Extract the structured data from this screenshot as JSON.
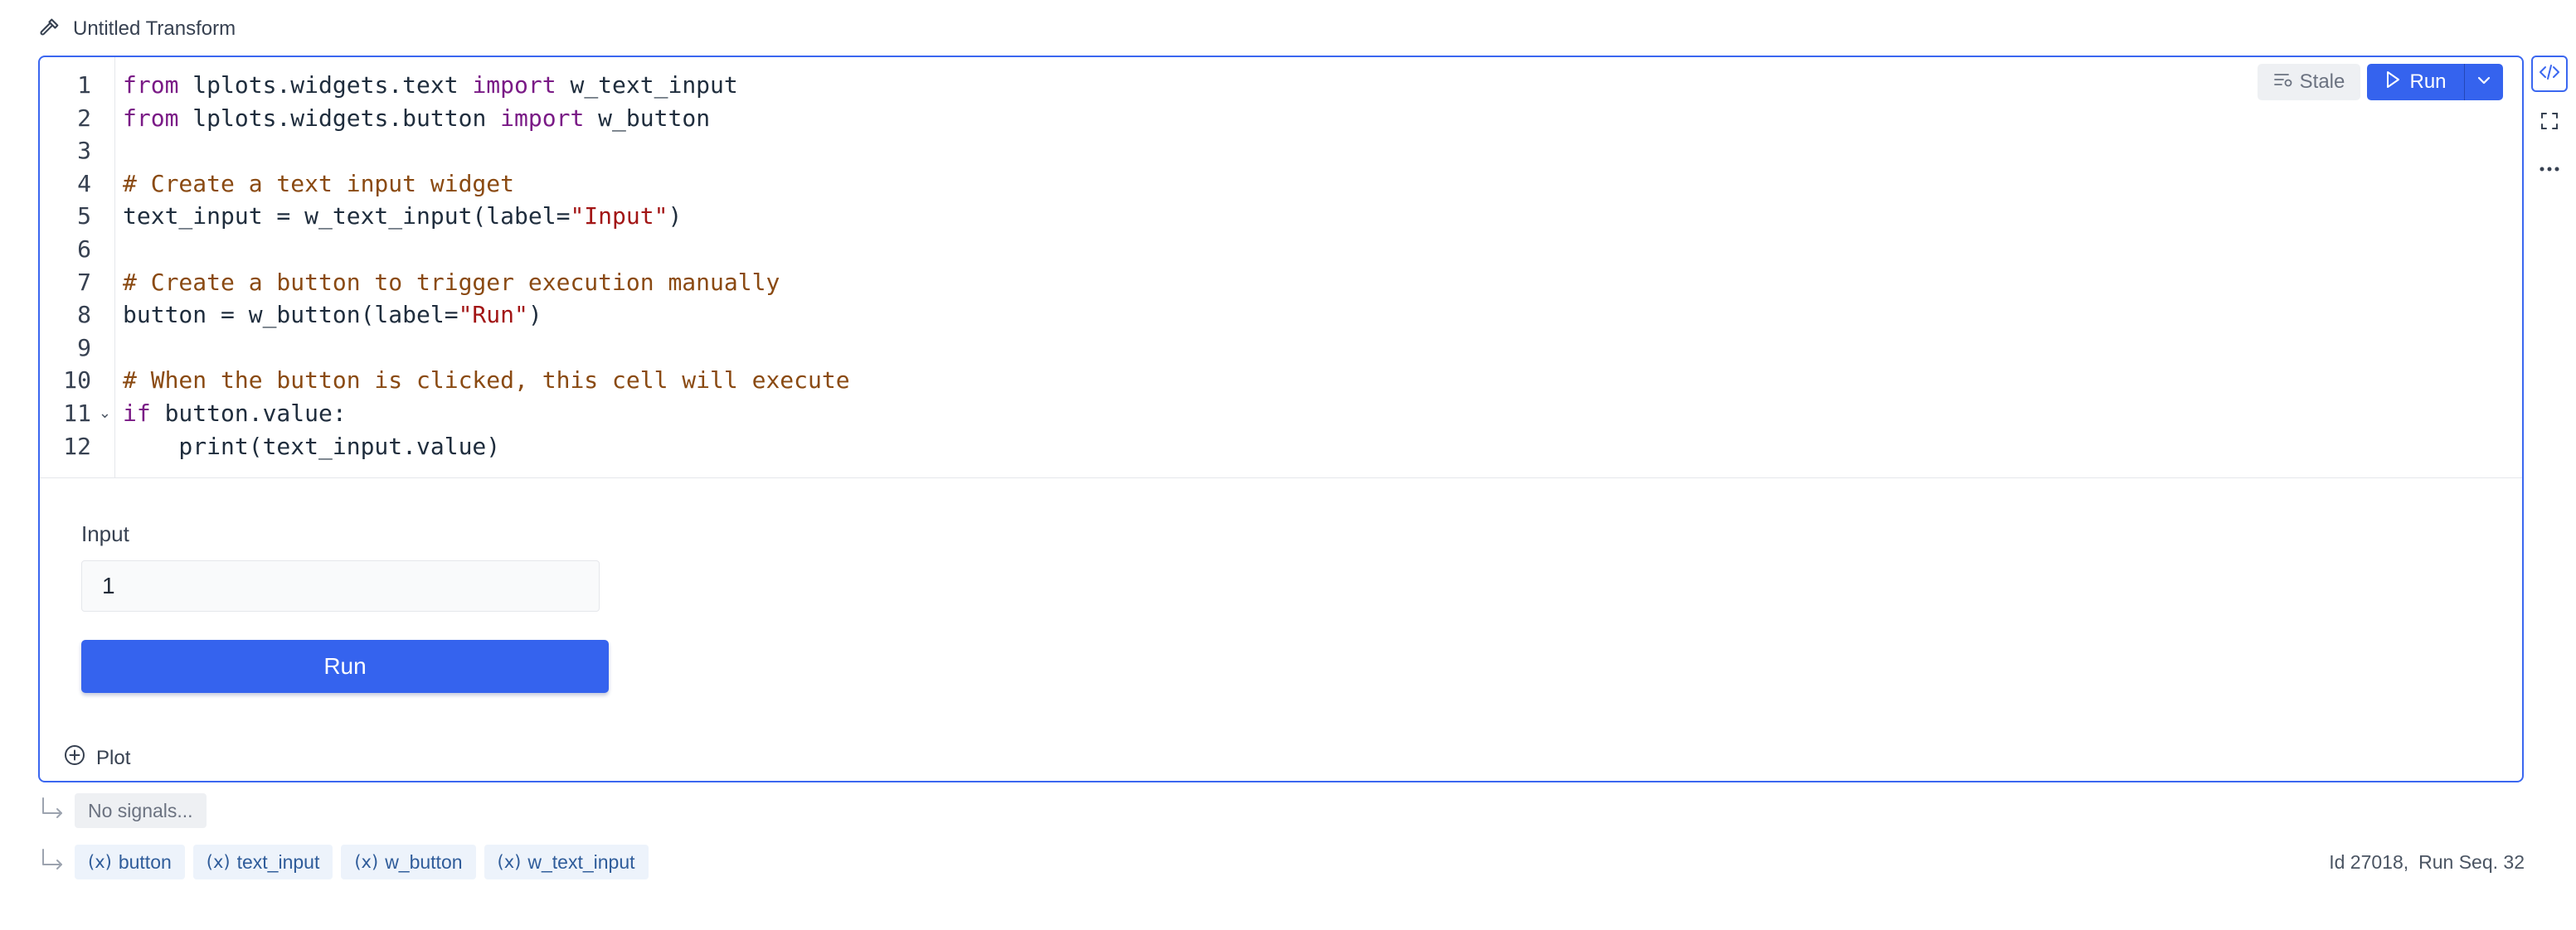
{
  "header": {
    "title": "Untitled Transform",
    "icon": "hammer-icon"
  },
  "editor": {
    "stale_label": "Stale",
    "run_label": "Run",
    "lines": [
      {
        "n": "1",
        "parts": [
          [
            "kw",
            "from"
          ],
          [
            "",
            " lplots.widgets.text "
          ],
          [
            "kw",
            "import"
          ],
          [
            "",
            " w_text_input"
          ]
        ]
      },
      {
        "n": "2",
        "parts": [
          [
            "kw",
            "from"
          ],
          [
            "",
            " lplots.widgets.button "
          ],
          [
            "kw",
            "import"
          ],
          [
            "",
            " w_button"
          ]
        ]
      },
      {
        "n": "3",
        "parts": []
      },
      {
        "n": "4",
        "parts": [
          [
            "cm",
            "# Create a text input widget"
          ]
        ]
      },
      {
        "n": "5",
        "parts": [
          [
            "",
            "text_input = w_text_input(label="
          ],
          [
            "st",
            "\"Input\""
          ],
          [
            "",
            ")"
          ]
        ]
      },
      {
        "n": "6",
        "parts": []
      },
      {
        "n": "7",
        "parts": [
          [
            "cm",
            "# Create a button to trigger execution manually"
          ]
        ]
      },
      {
        "n": "8",
        "parts": [
          [
            "",
            "button = w_button(label="
          ],
          [
            "st",
            "\"Run\""
          ],
          [
            "",
            ")"
          ]
        ]
      },
      {
        "n": "9",
        "parts": []
      },
      {
        "n": "10",
        "parts": [
          [
            "cm",
            "# When the button is clicked, this cell will execute"
          ]
        ]
      },
      {
        "n": "11",
        "parts": [
          [
            "kw",
            "if"
          ],
          [
            "",
            " button.value:"
          ]
        ],
        "fold": "⌄"
      },
      {
        "n": "12",
        "parts": [
          [
            "",
            "    print(text_input.value)"
          ]
        ]
      }
    ]
  },
  "output": {
    "input_label": "Input",
    "input_value": "1",
    "run_button_label": "Run",
    "plot_label": "Plot"
  },
  "signals": {
    "placeholder": "No signals..."
  },
  "variables": [
    "button",
    "text_input",
    "w_button",
    "w_text_input"
  ],
  "meta": {
    "id_text": "Id 27018,",
    "run_seq_text": "Run Seq. 32"
  },
  "colors": {
    "accent": "#3563ee",
    "frame": "#3b67f0",
    "keyword": "#7a1a86",
    "comment": "#8a4a12",
    "string": "#a21515"
  }
}
